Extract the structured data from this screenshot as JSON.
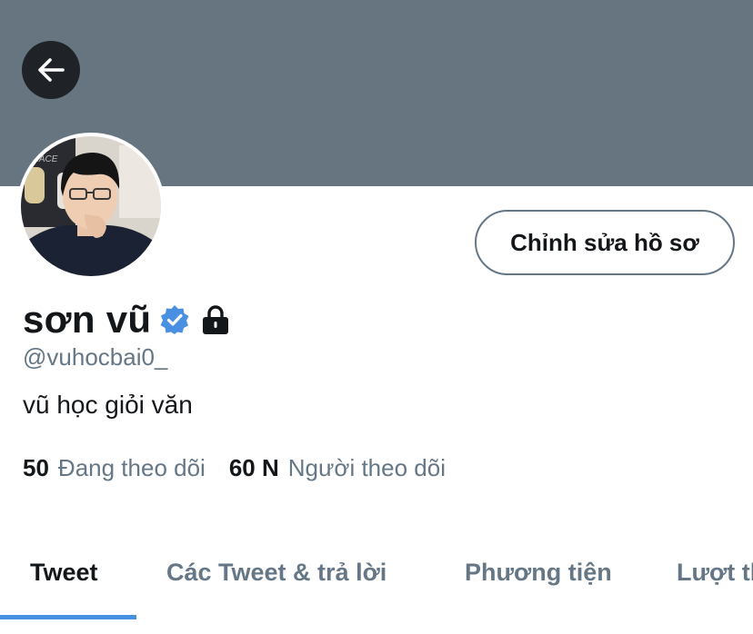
{
  "profile": {
    "display_name": "sơn vũ",
    "handle": "@vuhocbai0_",
    "bio": "vũ học giỏi văn",
    "verified": true,
    "protected": true
  },
  "header": {
    "back_icon": "arrow-left-icon",
    "edit_profile_label": "Chỉnh sửa hồ sơ"
  },
  "stats": {
    "following_count": "50",
    "following_label": "Đang theo dõi",
    "followers_count": "60 N",
    "followers_label": "Người theo dõi"
  },
  "tabs": [
    {
      "label": "Tweet",
      "active": true
    },
    {
      "label": "Các Tweet & trả lời",
      "active": false
    },
    {
      "label": "Phương tiện",
      "active": false
    },
    {
      "label": "Lượt thích",
      "active": false
    }
  ],
  "colors": {
    "banner": "#66757f",
    "accent": "#4a90e2",
    "verified_badge": "#4a90e2",
    "text_primary": "#14171a",
    "text_secondary": "#657786"
  }
}
